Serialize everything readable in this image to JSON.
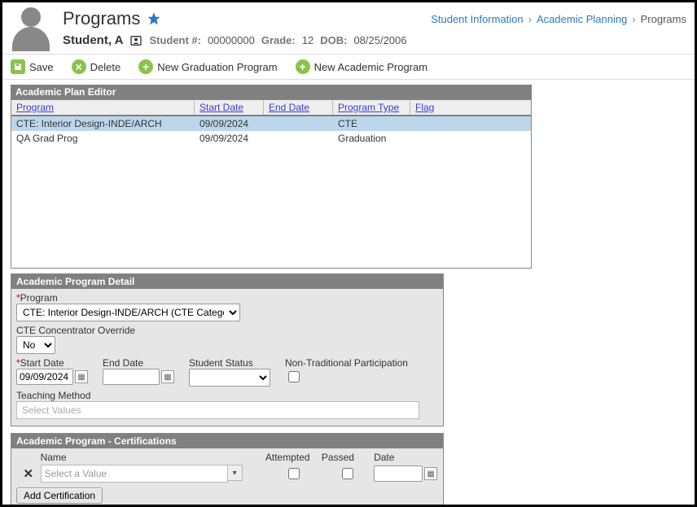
{
  "page": {
    "title": "Programs"
  },
  "breadcrumb": {
    "items": [
      "Student Information",
      "Academic Planning",
      "Programs"
    ]
  },
  "student": {
    "name": "Student, A",
    "num_label": "Student #:",
    "num": "00000000",
    "grade_label": "Grade:",
    "grade": "12",
    "dob_label": "DOB:",
    "dob": "08/25/2006"
  },
  "toolbar": {
    "save": "Save",
    "delete": "Delete",
    "newGrad": "New Graduation Program",
    "newAcad": "New Academic Program"
  },
  "editor": {
    "title": "Academic Plan Editor",
    "cols": {
      "program": "Program",
      "start": "Start Date",
      "end": "End Date",
      "type": "Program Type",
      "flag": "Flag"
    },
    "rows": [
      {
        "program": "CTE: Interior Design-INDE/ARCH",
        "start": "09/09/2024",
        "end": "",
        "type": "CTE",
        "selected": true
      },
      {
        "program": "QA Grad Prog",
        "start": "09/09/2024",
        "end": "",
        "type": "Graduation",
        "selected": false
      }
    ]
  },
  "detail": {
    "title": "Academic Program Detail",
    "labels": {
      "program": "Program",
      "concentrator": "CTE Concentrator Override",
      "start": "Start Date",
      "end": "End Date",
      "status": "Student Status",
      "ntp": "Non-Traditional Participation",
      "teaching": "Teaching Method"
    },
    "program_value": "CTE: Interior Design-INDE/ARCH (CTE Category",
    "concentrator_value": "No",
    "start_value": "09/09/2024",
    "end_value": "",
    "status_value": "",
    "teaching_placeholder": "Select Values"
  },
  "cert": {
    "title": "Academic Program - Certifications",
    "cols": {
      "name": "Name",
      "attempted": "Attempted",
      "passed": "Passed",
      "date": "Date"
    },
    "name_placeholder": "Select a Value",
    "add_btn": "Add Certification"
  }
}
